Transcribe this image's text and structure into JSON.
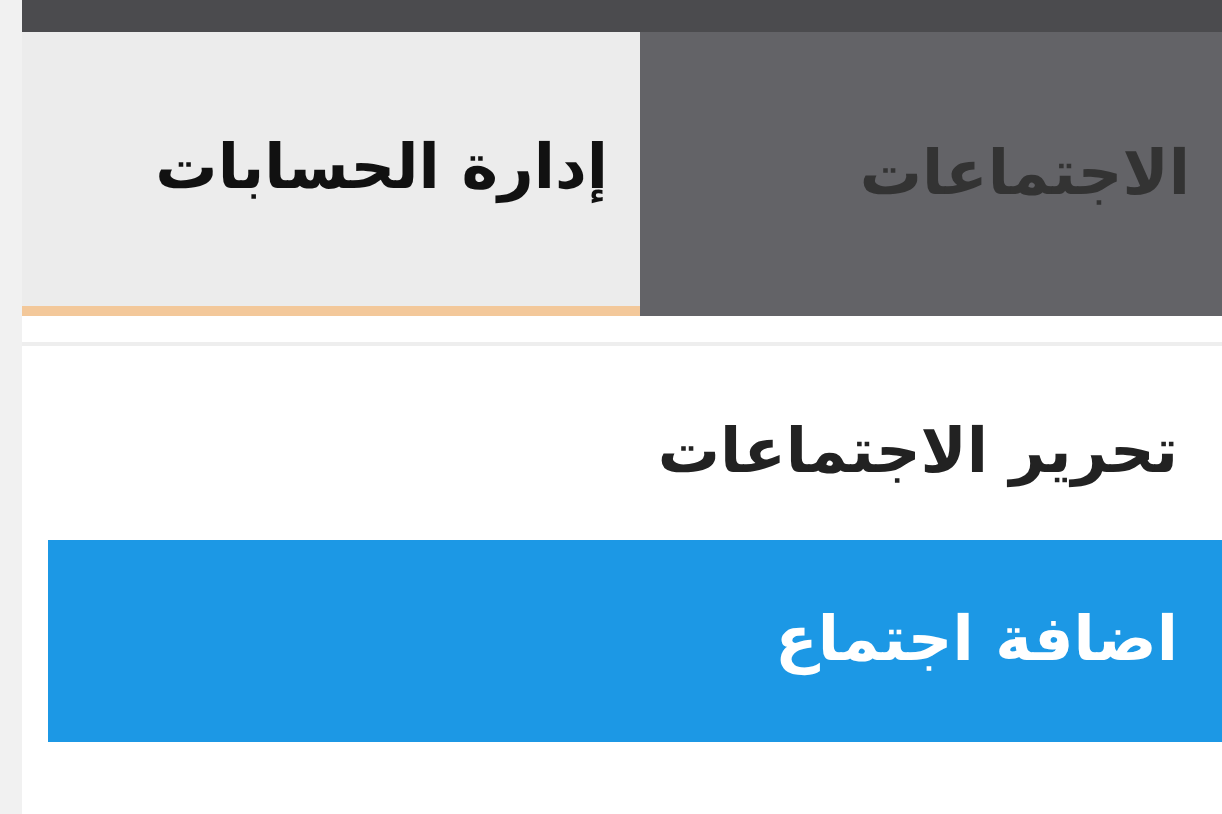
{
  "tabs": [
    {
      "label": "الاجتماعات",
      "selected": false
    },
    {
      "label": "إدارة الحسابات",
      "selected": true
    }
  ],
  "heading": "تحرير الاجتماعات",
  "add_button": {
    "label": "اضافة اجتماع"
  }
}
